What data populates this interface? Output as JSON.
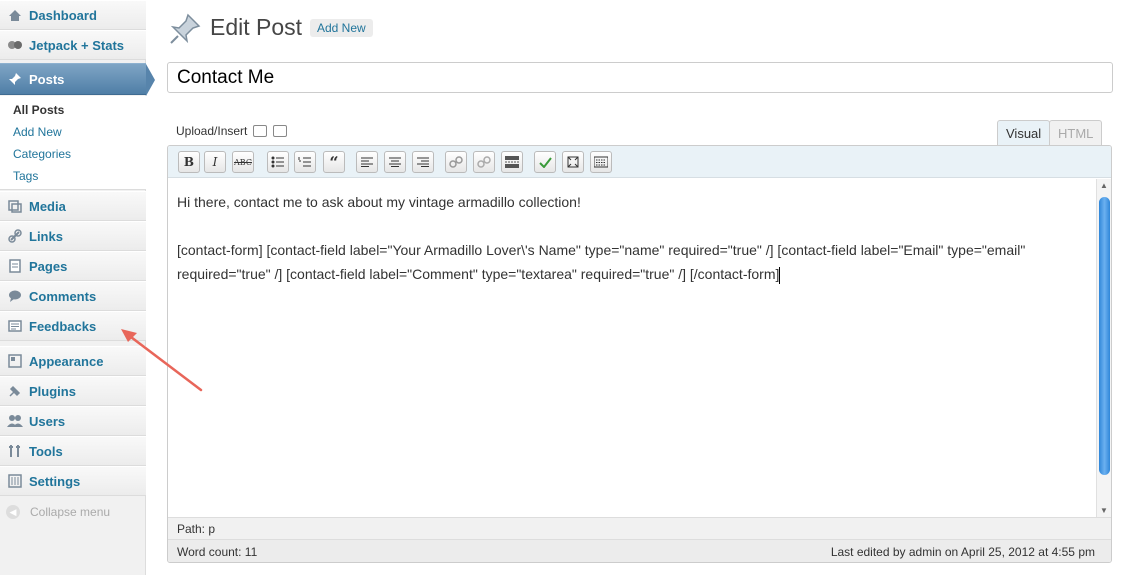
{
  "sidebar": {
    "items": [
      {
        "label": "Dashboard",
        "icon": "dashboard-icon"
      },
      {
        "label": "Jetpack + Stats",
        "icon": "jetpack-icon"
      },
      {
        "label": "Posts",
        "icon": "pushpin-icon"
      },
      {
        "label": "Media",
        "icon": "media-icon"
      },
      {
        "label": "Links",
        "icon": "link-icon"
      },
      {
        "label": "Pages",
        "icon": "pages-icon"
      },
      {
        "label": "Comments",
        "icon": "comment-icon"
      },
      {
        "label": "Feedbacks",
        "icon": "feedback-icon"
      },
      {
        "label": "Appearance",
        "icon": "appearance-icon"
      },
      {
        "label": "Plugins",
        "icon": "plugin-icon"
      },
      {
        "label": "Users",
        "icon": "users-icon"
      },
      {
        "label": "Tools",
        "icon": "tools-icon"
      },
      {
        "label": "Settings",
        "icon": "settings-icon"
      }
    ],
    "posts_submenu": [
      "All Posts",
      "Add New",
      "Categories",
      "Tags"
    ],
    "collapse_label": "Collapse menu"
  },
  "header": {
    "title": "Edit Post",
    "add_new": "Add New"
  },
  "post": {
    "title_value": "Contact Me"
  },
  "editor": {
    "upload_label": "Upload/Insert",
    "tabs": [
      "Visual",
      "HTML"
    ],
    "active_tab": "Visual",
    "toolbar_buttons": [
      {
        "label": "B",
        "name": "bold-button"
      },
      {
        "label": "I",
        "name": "italic-button"
      },
      {
        "label": "ABC",
        "name": "strikethrough-button"
      },
      {
        "label": "",
        "name": "bullet-list-button"
      },
      {
        "label": "",
        "name": "numbered-list-button"
      },
      {
        "label": "“",
        "name": "blockquote-button"
      },
      {
        "label": "",
        "name": "align-left-button"
      },
      {
        "label": "",
        "name": "align-center-button"
      },
      {
        "label": "",
        "name": "align-right-button"
      },
      {
        "label": "",
        "name": "insert-link-button"
      },
      {
        "label": "",
        "name": "unlink-button"
      },
      {
        "label": "",
        "name": "insert-more-button"
      },
      {
        "label": "",
        "name": "spellcheck-button"
      },
      {
        "label": "",
        "name": "fullscreen-button"
      },
      {
        "label": "",
        "name": "kitchen-sink-button"
      }
    ],
    "content_line1": "Hi there, contact me to ask about my vintage armadillo collection!",
    "content_line2": "[contact-form] [contact-field label=\"Your Armadillo Lover\\'s Name\" type=\"name\" required=\"true\" /] [contact-field label=\"Email\" type=\"email\" required=\"true\" /] [contact-field label=\"Comment\" type=\"textarea\" required=\"true\" /] [/contact-form]",
    "path": "Path: p",
    "word_count": "Word count: 11",
    "last_edited": "Last edited by admin on April 25, 2012 at 4:55 pm"
  },
  "colors": {
    "link": "#21759b",
    "active_menu": "#5784ab",
    "annotation_arrow": "#e8665a",
    "scroll_thumb": "#2f86d9"
  }
}
